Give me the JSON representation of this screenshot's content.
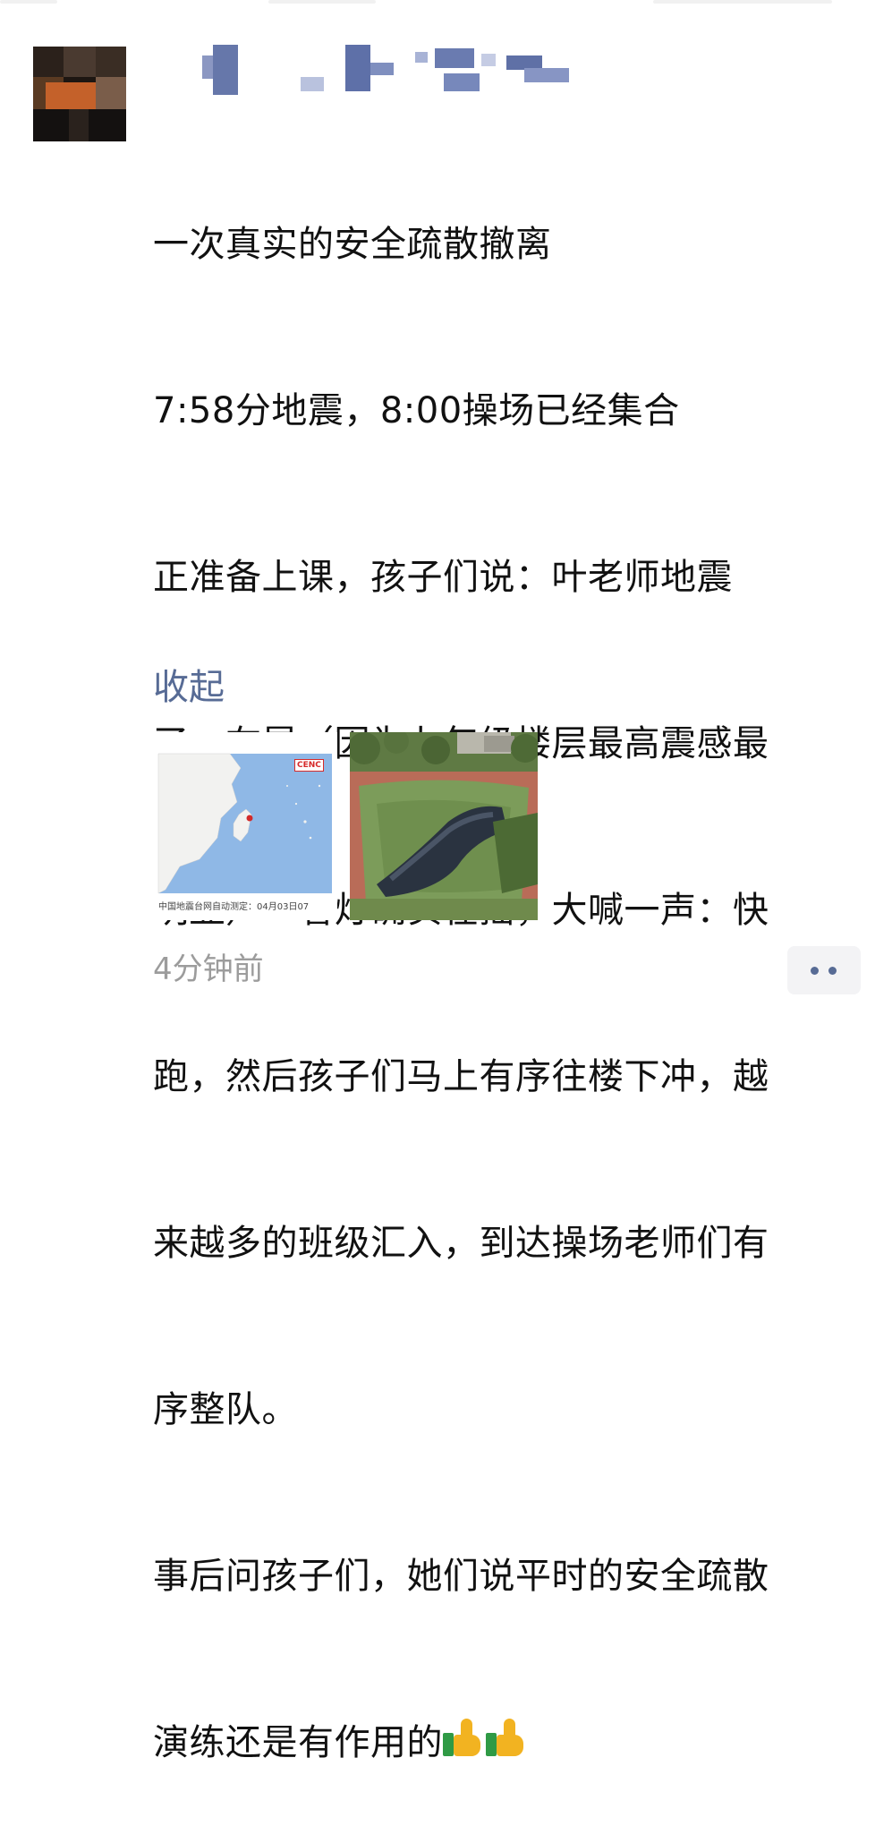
{
  "post": {
    "lines": [
      "一次真实的安全疏散撤离",
      "7:58分地震，8:00操场已经集合",
      "正准备上课，孩子们说：叶老师地震",
      "了，在晃（因为九年级楼层最高震感最",
      "明显）一看灯确实在摇，大喊一声：快",
      "跑，然后孩子们马上有序往楼下冲，越",
      "来越多的班级汇入，到达操场老师们有",
      "序整队。",
      "事后问孩子们，她们说平时的安全疏散"
    ],
    "last_line": "演练还是有作用的",
    "emoji": "thumbs-up-icon"
  },
  "collapse_label": "收起",
  "images": {
    "map_logo": "CENC",
    "map_caption": "中国地震台网自动测定：04月03日07"
  },
  "timestamp": "4分钟前",
  "colors": {
    "link": "#576b95",
    "timestamp": "#9c9c9c",
    "sea": "#8fb8e6"
  }
}
